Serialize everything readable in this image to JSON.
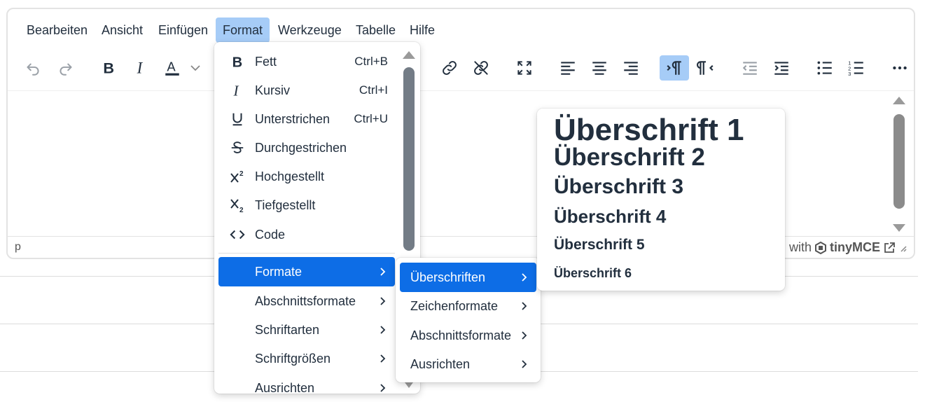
{
  "menubar": {
    "items": [
      {
        "label": "Bearbeiten"
      },
      {
        "label": "Ansicht"
      },
      {
        "label": "Einfügen"
      },
      {
        "label": "Format",
        "active": true
      },
      {
        "label": "Werkzeuge"
      },
      {
        "label": "Tabelle"
      },
      {
        "label": "Hilfe"
      }
    ]
  },
  "toolbar": {
    "icons": [
      "undo-icon",
      "redo-icon",
      "bold-icon",
      "italic-icon",
      "text-color-icon",
      "link-icon",
      "unlink-icon",
      "fullscreen-icon",
      "align-left-icon",
      "align-center-icon",
      "align-right-icon",
      "ltr-icon",
      "rtl-icon",
      "outdent-icon",
      "indent-icon",
      "bullet-list-icon",
      "numbered-list-icon",
      "more-icon"
    ]
  },
  "statusbar": {
    "path": "p",
    "brand_prefix": "d with",
    "brand_name": "tinyMCE"
  },
  "format_menu": {
    "items": [
      {
        "icon": "bold-icon",
        "label": "Fett",
        "shortcut": "Ctrl+B"
      },
      {
        "icon": "italic-icon",
        "label": "Kursiv",
        "shortcut": "Ctrl+I"
      },
      {
        "icon": "underline-icon",
        "label": "Unterstrichen",
        "shortcut": "Ctrl+U"
      },
      {
        "icon": "strikethrough-icon",
        "label": "Durchgestrichen"
      },
      {
        "icon": "superscript-icon",
        "label": "Hochgestellt"
      },
      {
        "icon": "subscript-icon",
        "label": "Tiefgestellt"
      },
      {
        "icon": "code-icon",
        "label": "Code"
      }
    ],
    "submenus": [
      {
        "label": "Formate",
        "selected": true
      },
      {
        "label": "Abschnittsformate"
      },
      {
        "label": "Schriftarten"
      },
      {
        "label": "Schriftgrößen"
      },
      {
        "label": "Ausrichten"
      }
    ]
  },
  "formats_menu": {
    "items": [
      {
        "label": "Überschriften",
        "selected": true
      },
      {
        "label": "Zeichenformate"
      },
      {
        "label": "Abschnittsformate"
      },
      {
        "label": "Ausrichten"
      }
    ]
  },
  "headings_menu": {
    "items": [
      "Überschrift 1",
      "Überschrift 2",
      "Überschrift 3",
      "Überschrift 4",
      "Überschrift 5",
      "Überschrift 6"
    ]
  },
  "colors": {
    "accent": "#0d6de6",
    "active": "#a6ccf7",
    "text": "#222f3e"
  }
}
